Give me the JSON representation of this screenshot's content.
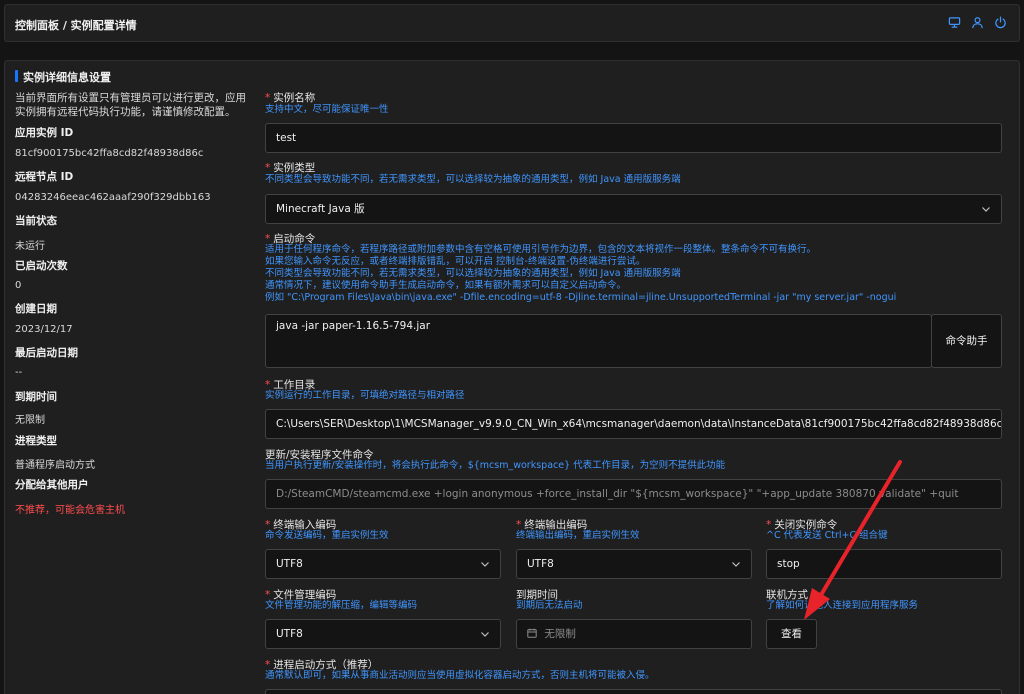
{
  "header": {
    "title": "控制面板 / 实例配置详情"
  },
  "card": {
    "title": "实例详细信息设置"
  },
  "info": {
    "intro": "当前界面所有设置只有管理员可以进行更改，应用实例拥有远程代码执行功能，请谨慎修改配置。",
    "rows": [
      {
        "key": "应用实例 ID",
        "value": "81cf900175bc42ffa8cd82f48938d86c"
      },
      {
        "key": "远程节点 ID",
        "value": "04283246eeac462aaaf290f329dbb163"
      },
      {
        "key": "当前状态",
        "value": "未运行"
      },
      {
        "key": "已启动次数",
        "value": "0"
      },
      {
        "key": "创建日期",
        "value": "2023/12/17"
      },
      {
        "key": "最后启动日期",
        "value": "--"
      },
      {
        "key": "到期时间",
        "value": "无限制"
      },
      {
        "key": "进程类型",
        "value": "普通程序启动方式"
      },
      {
        "key": "分配给其他用户",
        "value": "不推荐，可能会危害主机"
      }
    ]
  },
  "form": {
    "name": {
      "label": "实例名称",
      "desc": "支持中文，尽可能保证唯一性",
      "value": "test"
    },
    "type": {
      "label": "实例类型",
      "desc": "不同类型会导致功能不同，若无需求类型，可以选择较为抽象的通用类型，例如 Java 通用版服务端",
      "value": "Minecraft Java 版"
    },
    "command": {
      "label": "启动命令",
      "desc": [
        "适用于任何程序命令，若程序路径或附加参数中含有空格可使用引号作为边界，包含的文本将视作一段整体。整条命令不可有换行。",
        "如果您输入命令无反应，或者终端排版错乱，可以开启 控制台-终端设置-伪终端进行尝试。",
        "不同类型会导致功能不同，若无需求类型，可以选择较为抽象的通用类型，例如 Java 通用版服务端",
        "通常情况下，建议使用命令助手生成启动命令，如果有额外需求可以自定义启动命令。",
        "例如 \"C:\\Program Files\\Java\\bin\\java.exe\" -Dfile.encoding=utf-8 -Djline.terminal=jline.UnsupportedTerminal -jar \"my server.jar\" -nogui"
      ],
      "value": "java -jar paper-1.16.5-794.jar",
      "helper": "命令助手"
    },
    "cwd": {
      "label": "工作目录",
      "desc": "实例运行的工作目录，可填绝对路径与相对路径",
      "value": "C:\\Users\\SER\\Desktop\\1\\MCSManager_v9.9.0_CN_Win_x64\\mcsmanager\\daemon\\data\\InstanceData\\81cf900175bc42ffa8cd82f48938d86c"
    },
    "update": {
      "label": "更新/安装程序文件命令",
      "desc": "当用户执行更新/安装操作时，将会执行此命令，${mcsm_workspace} 代表工作目录，为空则不提供此功能",
      "value": "D:/SteamCMD/steamcmd.exe +login anonymous +force_install_dir \"${mcsm_workspace}\" \"+app_update 380870 validate\" +quit"
    },
    "in_enc": {
      "label": "终端输入编码",
      "desc": "命令发送编码，重启实例生效",
      "value": "UTF8"
    },
    "out_enc": {
      "label": "终端输出编码",
      "desc": "终端输出编码，重启实例生效",
      "value": "UTF8"
    },
    "stop": {
      "label": "关闭实例命令",
      "desc": "^C 代表发送 Ctrl+C 组合键",
      "value": "stop"
    },
    "file_enc": {
      "label": "文件管理编码",
      "desc": "文件管理功能的解压缩，编辑等编码",
      "value": "UTF8"
    },
    "expire": {
      "label": "到期时间",
      "desc": "到期后无法启动",
      "placeholder": "无限制"
    },
    "connect": {
      "label": "联机方式",
      "desc": "了解如何让他人连接到应用程序服务",
      "button": "查看"
    },
    "process": {
      "label": "进程启动方式（推荐）",
      "desc": "通常默认即可，如果从事商业活动则应当使用虚拟化容器启动方式，否则主机将可能被入侵。"
    }
  },
  "colors": {
    "accent": "#1677ff",
    "description": "#4096ff",
    "required": "#ff4d4f",
    "annotation_arrow": "#e8232a"
  },
  "icons": [
    "dashboard-icon",
    "user-icon",
    "power-icon",
    "chevron-down-icon",
    "calendar-icon"
  ]
}
